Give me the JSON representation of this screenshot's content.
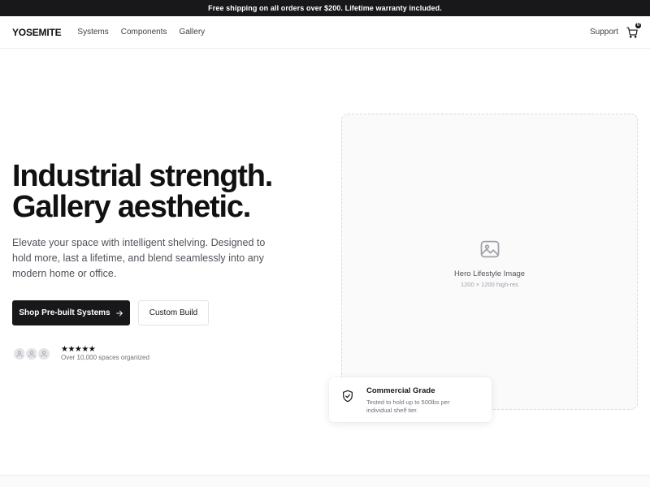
{
  "announcement": "Free shipping on all orders over $200. Lifetime warranty included.",
  "nav": {
    "logo": "YOSEMITE",
    "links": [
      "Systems",
      "Components",
      "Gallery"
    ],
    "support": "Support",
    "cart_count": "0"
  },
  "hero": {
    "title_line1": "Industrial strength.",
    "title_line2": "Gallery aesthetic.",
    "description": "Elevate your space with intelligent shelving. Designed to hold more, last a lifetime, and blend seamlessly into any modern home or office.",
    "primary_button": "Shop Pre-built Systems",
    "secondary_button": "Custom Build",
    "stars": "★★★★★",
    "social_proof": "Over 10,000 spaces organized",
    "rating": 5
  },
  "image_placeholder": {
    "label": "Hero Lifestyle Image",
    "sub": "1200 × 1200 high-res"
  },
  "badge": {
    "title": "Commercial Grade",
    "text": "Tested to hold up to 500lbs per individual shelf tier."
  },
  "colors": {
    "primary": "#18181b",
    "muted_text": "#52525b",
    "border": "#e4e4e7"
  }
}
